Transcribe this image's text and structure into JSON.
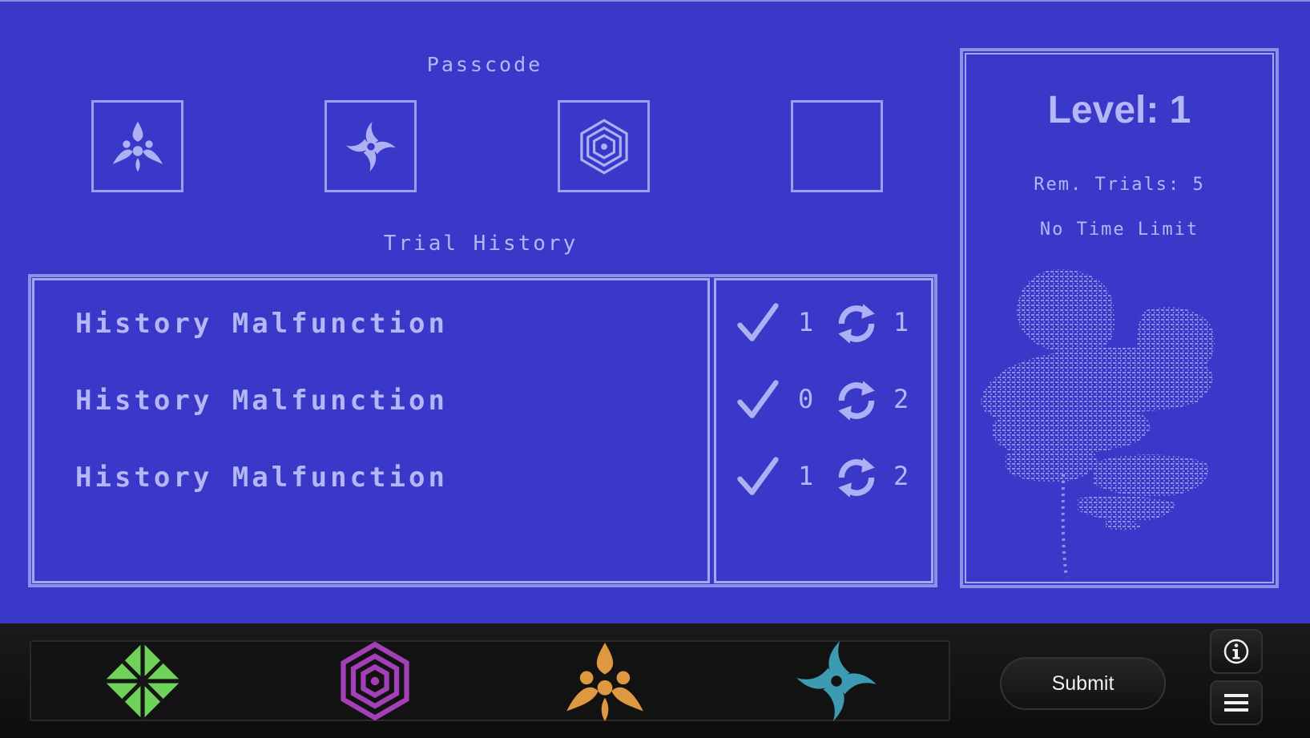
{
  "passcode": {
    "title": "Passcode",
    "slots": [
      {
        "icon": "flower-icon"
      },
      {
        "icon": "swirl-icon"
      },
      {
        "icon": "hexagon-icon"
      },
      {
        "icon": "empty"
      }
    ]
  },
  "history": {
    "title": "Trial History",
    "rows": [
      {
        "text": "History Malfunction",
        "correct": "1",
        "misplaced": "1"
      },
      {
        "text": "History Malfunction",
        "correct": "0",
        "misplaced": "2"
      },
      {
        "text": "History Malfunction",
        "correct": "1",
        "misplaced": "2"
      }
    ]
  },
  "info": {
    "level": "Level: 1",
    "remaining_trials": "Rem. Trials: 5",
    "time_limit": "No Time Limit"
  },
  "tray": {
    "items": [
      {
        "icon": "green-diamond-icon",
        "color": "#6fd35b"
      },
      {
        "icon": "purple-hexagon-icon",
        "color": "#a340b8"
      },
      {
        "icon": "orange-flower-icon",
        "color": "#dd9840"
      },
      {
        "icon": "teal-swirl-icon",
        "color": "#3c9ab2"
      }
    ]
  },
  "controls": {
    "submit_label": "Submit",
    "info_icon": "info-icon",
    "menu_icon": "menu-icon"
  },
  "colors": {
    "background": "#3a38c8",
    "symbol": "#aeb0f4",
    "bar": "#111111"
  }
}
